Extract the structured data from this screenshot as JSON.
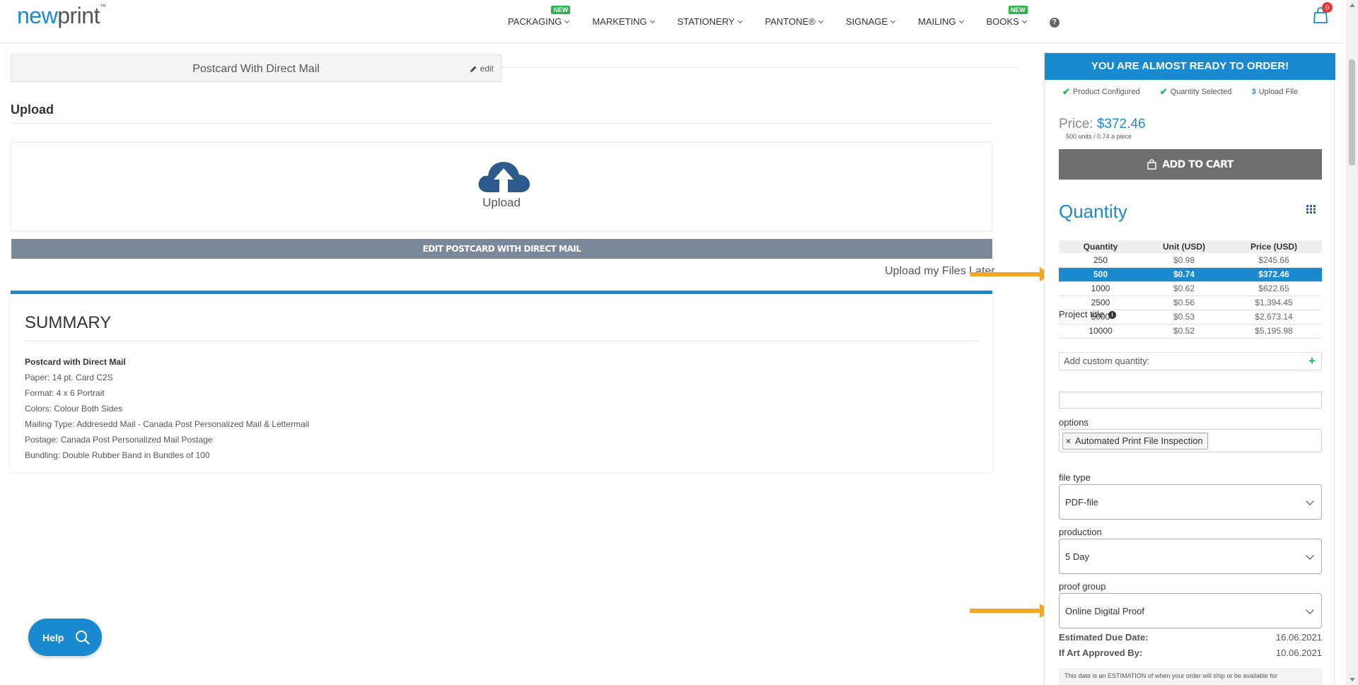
{
  "header": {
    "logo": {
      "part1": "new",
      "part2": "print",
      "tm": "™"
    },
    "nav": [
      {
        "label": "PACKAGING",
        "badge": "NEW"
      },
      {
        "label": "MARKETING",
        "badge": ""
      },
      {
        "label": "STATIONERY",
        "badge": ""
      },
      {
        "label": "PANTONE®",
        "badge": ""
      },
      {
        "label": "SIGNAGE",
        "badge": ""
      },
      {
        "label": "MAILING",
        "badge": ""
      },
      {
        "label": "BOOKS",
        "badge": "NEW"
      }
    ],
    "help_icon": "?",
    "cart_count": "0"
  },
  "product": {
    "title": "Postcard With Direct Mail",
    "edit_label": "edit"
  },
  "upload": {
    "heading": "Upload",
    "button_label": "Upload",
    "edit_bar_label": "EDIT POSTCARD WITH DIRECT MAIL",
    "later_label": "Upload my Files Later"
  },
  "summary": {
    "title": "SUMMARY",
    "product_name": "Postcard with Direct Mail",
    "lines": [
      "Paper: 14 pt. Card C2S",
      "Format: 4 x 6 Portrait",
      "Colors: Colour Both Sides",
      "Mailing Type: Addresedd Mail - Canada Post Personalized Mail & Lettermail",
      "Postage: Canada Post Personalized Mail Postage",
      "Bundling: Double Rubber Band in Bundles of 100"
    ]
  },
  "help_button": {
    "label": "Help"
  },
  "sidebar": {
    "ready_banner": "YOU ARE ALMOST READY TO ORDER!",
    "steps": [
      {
        "marker": "✔",
        "label": "Product Configured"
      },
      {
        "marker": "✔",
        "label": "Quantity Selected"
      },
      {
        "marker": "3",
        "label": "Upload File"
      }
    ],
    "price_label": "Price:",
    "price_value": "$372.46",
    "price_sub": "500 units / 0.74 a piece",
    "add_to_cart": "ADD TO CART",
    "quantity_heading": "Quantity",
    "table": {
      "headers": [
        "Quantity",
        "Unit (USD)",
        "Price (USD)"
      ],
      "rows": [
        [
          "250",
          "$0.98",
          "$245.66"
        ],
        [
          "500",
          "$0.74",
          "$372.46"
        ],
        [
          "1000",
          "$0.62",
          "$622.65"
        ],
        [
          "2500",
          "$0.56",
          "$1,394.45"
        ],
        [
          "5000",
          "$0.53",
          "$2,673.14"
        ],
        [
          "10000",
          "$0.52",
          "$5,195.98"
        ]
      ]
    },
    "custom_quantity_placeholder": "Add custom quantity:",
    "project_title_label": "Project title",
    "project_title_value": "",
    "options_label": "options",
    "options_tag": "Automated Print File Inspection",
    "options_tag_remove": "×",
    "file_type_label": "file type",
    "file_type_value": "PDF-file",
    "production_label": "production",
    "production_value": "5 Day",
    "proof_group_label": "proof group",
    "proof_group_value": "Online Digital Proof",
    "estimated_due_label": "Estimated Due Date:",
    "estimated_due_value": "16.06.2021",
    "art_approved_label": "If Art Approved By:",
    "art_approved_value": "10.06.2021",
    "estimation_note": "This date is an ESTIMATION of when your order will ship or be available for"
  },
  "colors": {
    "accent": "#1a8ad0",
    "arrow": "#f5a623",
    "new_badge": "#26b54b",
    "cart_badge": "#e53935"
  }
}
